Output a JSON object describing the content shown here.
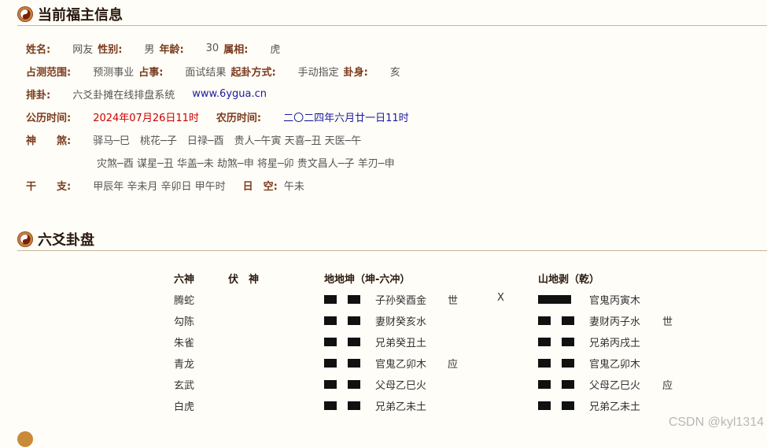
{
  "section1": {
    "title": "当前福主信息"
  },
  "info": {
    "name_label": "姓名:",
    "name_value": "网友",
    "gender_label": "性别:",
    "gender_value": "男",
    "age_label": "年龄:",
    "age_value": "30",
    "zodiac_label": "属相:",
    "zodiac_value": "虎",
    "scope_label": "占测范围:",
    "scope_value": "预测事业",
    "matter_label": "占事:",
    "matter_value": "面试结果",
    "method_label": "起卦方式:",
    "method_value": "手动指定",
    "body_label": "卦身:",
    "body_value": "亥",
    "paigua_label": "排卦:",
    "paigua_value": "六爻卦摊在线排盘系统",
    "paigua_link": "www.6ygua.cn",
    "solar_label": "公历时间:",
    "solar_value": "2024年07月26日11时",
    "lunar_label": "农历时间:",
    "lunar_value": "二〇二四年六月廿一日11时",
    "shensha_label": "神　　煞:",
    "shensha_line1": "驿马─巳　桃花─子　日禄─酉　贵人─午寅 天喜─丑 天医─午",
    "shensha_line2": "灾煞─酉 谋星─丑 华盖─未 劫煞─申 将星─卯 贵文昌人─子 羊刃─申",
    "ganzhi_label": "干　　支:",
    "ganzhi_value": "甲辰年 辛未月 辛卯日 甲午时",
    "kong_label": "日　空:",
    "kong_value": "午未"
  },
  "section2": {
    "title": "六爻卦盘"
  },
  "pan": {
    "col_liushen": "六神",
    "col_fushen": "伏　神",
    "main_gua": "地地坤（坤-六冲）",
    "changed_gua": "山地剥（乾）",
    "rows": [
      {
        "liushen": "腾蛇",
        "main_yao": "yin",
        "main_text": "子孙癸酉金",
        "main_mark": "世",
        "moving": "X",
        "changed_yao": "yang",
        "changed_text": "官鬼丙寅木",
        "changed_mark": ""
      },
      {
        "liushen": "勾陈",
        "main_yao": "yin",
        "main_text": "妻财癸亥水",
        "main_mark": "",
        "moving": "",
        "changed_yao": "yin",
        "changed_text": "妻财丙子水",
        "changed_mark": "世"
      },
      {
        "liushen": "朱雀",
        "main_yao": "yin",
        "main_text": "兄弟癸丑土",
        "main_mark": "",
        "moving": "",
        "changed_yao": "yin",
        "changed_text": "兄弟丙戌土",
        "changed_mark": ""
      },
      {
        "liushen": "青龙",
        "main_yao": "yin",
        "main_text": "官鬼乙卯木",
        "main_mark": "应",
        "moving": "",
        "changed_yao": "yin",
        "changed_text": "官鬼乙卯木",
        "changed_mark": ""
      },
      {
        "liushen": "玄武",
        "main_yao": "yin",
        "main_text": "父母乙巳火",
        "main_mark": "",
        "moving": "",
        "changed_yao": "yin",
        "changed_text": "父母乙巳火",
        "changed_mark": "应"
      },
      {
        "liushen": "白虎",
        "main_yao": "yin",
        "main_text": "兄弟乙未土",
        "main_mark": "",
        "moving": "",
        "changed_yao": "yin",
        "changed_text": "兄弟乙未土",
        "changed_mark": ""
      }
    ]
  },
  "watermark": "CSDN @kyl1314"
}
